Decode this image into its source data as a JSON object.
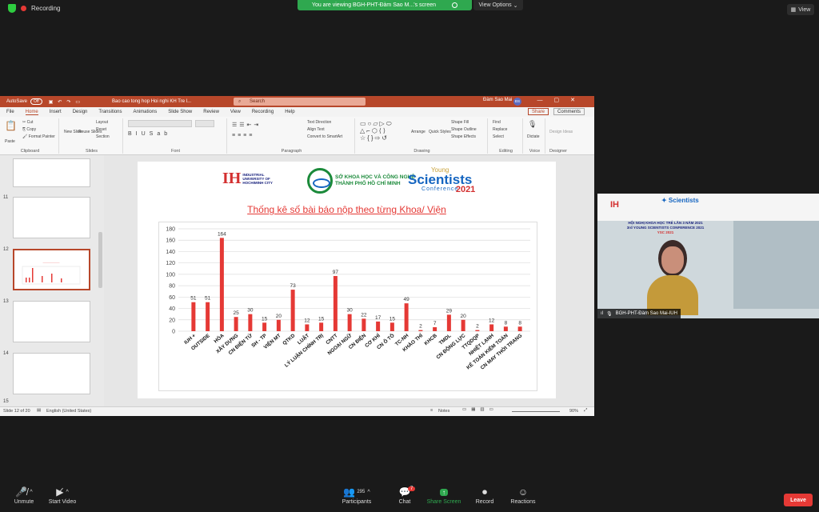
{
  "zoom": {
    "recording_label": "Recording",
    "viewing_text": "You are viewing BGH-PHT-Đàm Sao M...'s screen",
    "view_options": "View Options",
    "view_button": "View",
    "toolbar": {
      "unmute": "Unmute",
      "start_video": "Start Video",
      "participants": "Participants",
      "participants_count": "295",
      "chat": "Chat",
      "chat_badge": "7",
      "share_screen": "Share Screen",
      "record": "Record",
      "reactions": "Reactions",
      "leave": "Leave"
    },
    "video_name": "BGH-PHT-Đàm Sao Mai-IUH",
    "video_banner": {
      "line1": "HỘI NGHỊ KHOA HỌC TRẺ LẦN 3 NĂM 2021",
      "line2": "3rd YOUNG SCIENTISTS CONFERENCE 2021",
      "line3": "YSC 2021"
    }
  },
  "ppt": {
    "autosave": "AutoSave",
    "autosave_state": "Off",
    "doc_title": "Bao cao tong hop Hoi nghi KH Tre l...",
    "search": "Search",
    "user": "Đàm Sao Mai",
    "user_initials": "ĐS",
    "menu": [
      "File",
      "Home",
      "Insert",
      "Design",
      "Transitions",
      "Animations",
      "Slide Show",
      "Review",
      "View",
      "Recording",
      "Help"
    ],
    "share": "Share",
    "comments": "Comments",
    "ribbon": {
      "clipboard": "Clipboard",
      "paste": "Paste",
      "cut": "Cut",
      "copy": "Copy",
      "format_painter": "Format Painter",
      "slides": "Slides",
      "new_slide": "New Slide",
      "reuse_slides": "Reuse Slides",
      "layout": "Layout",
      "reset": "Reset",
      "section": "Section",
      "font": "Font",
      "paragraph": "Paragraph",
      "text_direction": "Text Direction",
      "align_text": "Align Text",
      "convert_smartart": "Convert to SmartArt",
      "drawing": "Drawing",
      "arrange": "Arrange",
      "quick_styles": "Quick Styles",
      "shape_fill": "Shape Fill",
      "shape_outline": "Shape Outline",
      "shape_effects": "Shape Effects",
      "editing": "Editing",
      "find": "Find",
      "replace": "Replace",
      "select": "Select",
      "voice": "Voice",
      "dictate": "Dictate",
      "designer": "Designer",
      "design_ideas": "Design Ideas"
    },
    "thumbnails": [
      {
        "num": "11"
      },
      {
        "num": "12"
      },
      {
        "num": "13"
      },
      {
        "num": "14"
      },
      {
        "num": "15"
      }
    ],
    "status": {
      "slide_of": "Slide 12 of 20",
      "language": "English (United States)",
      "notes": "Notes",
      "zoom": "90%"
    }
  },
  "slide": {
    "iuh_line1": "INDUSTRIAL",
    "iuh_line2": "UNIVERSITY OF",
    "iuh_line3": "HOCHIMINH CITY",
    "so_line1": "SỞ KHOA HỌC VÀ CÔNG NGHỆ",
    "so_line2": "THÀNH PHỐ HỒ CHÍ MINH",
    "ysc_young": "Young",
    "ysc_scientists": "Scientists",
    "ysc_conference": "Conference",
    "ysc_year": "2021",
    "title": "Thống kê số bài báo nộp theo từng Khoa/ Viện"
  },
  "chart_data": {
    "type": "bar",
    "title": "",
    "xlabel": "",
    "ylabel": "",
    "ylim": [
      0,
      180
    ],
    "yticks": [
      0,
      20,
      40,
      60,
      80,
      100,
      120,
      140,
      160,
      180
    ],
    "grid": true,
    "color": "#e53935",
    "categories": [
      "IUH +",
      "OUTSIDE",
      "HÓA",
      "XÂY DỰNG",
      "CN ĐIỆN TỬ",
      "SH - TP",
      "VIỆN MT",
      "QTKD",
      "LUẬT",
      "LÝ LUẬN CHÍNH TRỊ",
      "CNTT",
      "NGOẠI NGỮ",
      "CN ĐIỆN",
      "CƠ KHÍ",
      "CN Ô TÔ",
      "TC-NH",
      "KHẢO THÍ",
      "KHCB",
      "TMDL",
      "CN ĐỘNG LỰC",
      "TTQDQP",
      "NHIỆT LẠNH",
      "KẾ TOÁN KIỂM TOÁN",
      "CN MAY THỜI TRANG"
    ],
    "values": [
      51,
      51,
      164,
      25,
      30,
      15,
      20,
      73,
      12,
      15,
      97,
      30,
      22,
      17,
      15,
      49,
      2,
      7,
      29,
      20,
      2,
      12,
      8,
      8
    ]
  }
}
